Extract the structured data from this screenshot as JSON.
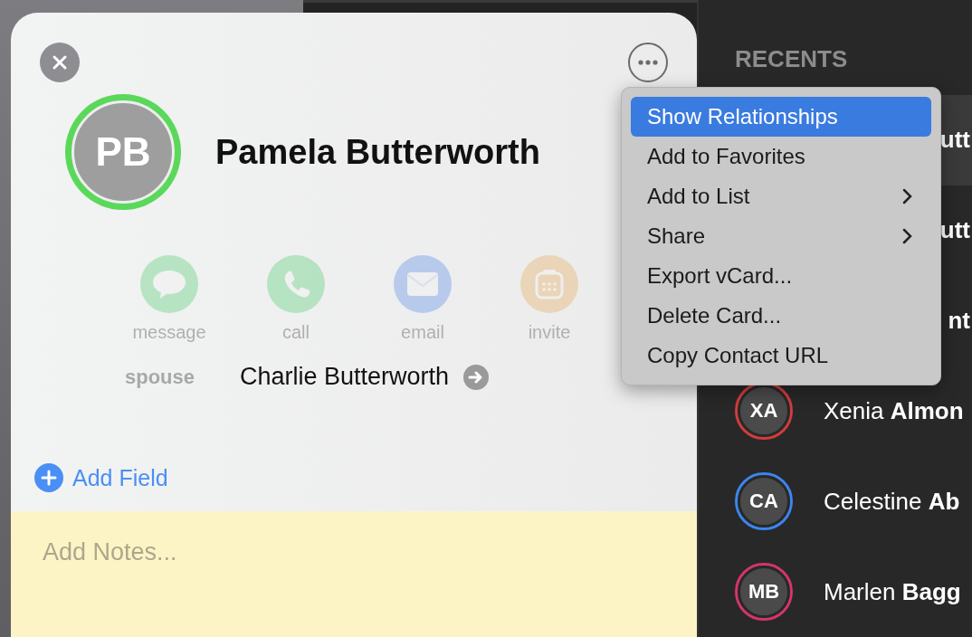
{
  "contact_card": {
    "initials": "PB",
    "name": "Pamela Butterworth",
    "actions": [
      {
        "kind": "message",
        "label": "message",
        "disabled": true
      },
      {
        "kind": "call",
        "label": "call",
        "disabled": true
      },
      {
        "kind": "email",
        "label": "email",
        "disabled": true
      },
      {
        "kind": "invite",
        "label": "invite",
        "disabled": true
      }
    ],
    "related": {
      "label": "spouse",
      "value": "Charlie Butterworth"
    },
    "add_field": "Add Field",
    "notes": {
      "placeholder": "Add Notes..."
    }
  },
  "menu": [
    {
      "label": "Show Relationships",
      "selected": true,
      "submenu": false
    },
    {
      "label": "Add to Favorites",
      "selected": false,
      "submenu": false
    },
    {
      "label": "Add to List",
      "selected": false,
      "submenu": true
    },
    {
      "label": "Share",
      "selected": false,
      "submenu": true
    },
    {
      "label": "Export vCard...",
      "selected": false,
      "submenu": false
    },
    {
      "label": "Delete Card...",
      "selected": false,
      "submenu": false
    },
    {
      "label": "Copy Contact URL",
      "selected": false,
      "submenu": false
    }
  ],
  "recents": {
    "title": "RECENTS",
    "items": [
      {
        "name": "**utt**",
        "selected": true
      },
      {
        "name": "**utt**",
        "selected": false
      },
      {
        "name": "**nt**",
        "selected": false
      },
      {
        "initials": "XA",
        "name": "Xenia **Almon**",
        "color": "#d63b3b",
        "selected": false
      },
      {
        "initials": "CA",
        "name": "Celestine **Ab**",
        "color": "#3b86f2",
        "selected": false
      },
      {
        "initials": "MB",
        "name": "Marlen **Bagg**",
        "color": "#d8336f",
        "selected": false
      }
    ]
  }
}
